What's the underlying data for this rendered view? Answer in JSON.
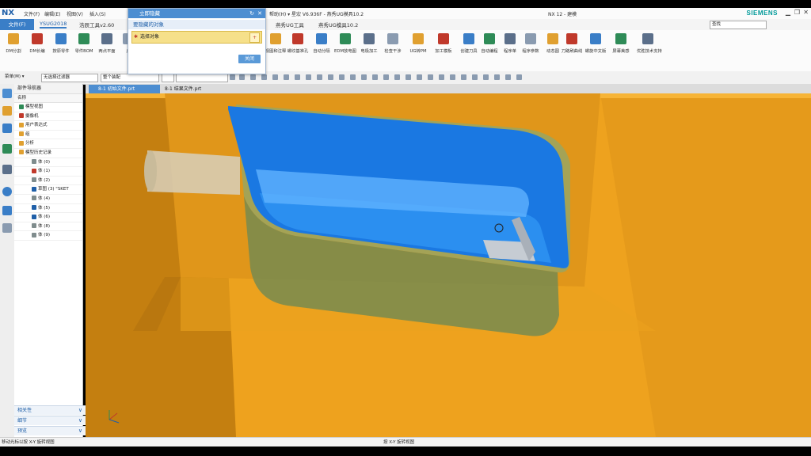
{
  "app": {
    "logo": "NX",
    "title": "NX 12 - 建模",
    "brand": "SIEMENS",
    "accent": "#3a7ec7",
    "menu": [
      "文件(F)",
      "编辑(E)",
      "视图(V)",
      "插入(S)"
    ],
    "secondary_window": "帮助(H) ▾ 星宏 V6.936F - 燕秀UG模具10.2"
  },
  "popup": {
    "title": "立即隐藏",
    "section": "要隐藏的对象",
    "row_label": "选择对象",
    "ok_label": "关闭"
  },
  "ribbon_tabs": {
    "file": "文件(F)",
    "tabs": [
      "YSUG2018",
      "浩辰工具v2.60",
      "燕秀UG工具",
      "燕秀UG模具10.2"
    ],
    "search_placeholder": "查找"
  },
  "ribbon_buttons": [
    "DM分割",
    "DM长编",
    "按原零件",
    "零件BOM",
    "两点平面",
    "虚",
    "视图和注释",
    "螺纹基准孔",
    "自动分隔",
    "EDM放电图",
    "电极加工",
    "检查干涉",
    "UG转PM",
    "加工模板",
    "创建刀具",
    "自动编程",
    "程序单",
    "程序参数",
    "动态圆",
    "刀路刷曲线",
    "螺旋中文版",
    "屏幕美感",
    "优胜技术支持"
  ],
  "toolbar2": {
    "menu_label": "菜单(M) ▾",
    "filter_label": "无选择过滤器",
    "assembly_label": "整个装配"
  },
  "navigator": {
    "title": "部件导航器",
    "column": "名称",
    "items": [
      {
        "label": "模型视图",
        "color": "#2e8b57"
      },
      {
        "label": "摄像机",
        "color": "#c0392b"
      },
      {
        "label": "用户表达式",
        "color": "#e0a030"
      },
      {
        "label": "组",
        "color": "#e0a030"
      },
      {
        "label": "分析",
        "color": "#e0a030"
      },
      {
        "label": "模型历史记录",
        "color": "#e0a030"
      },
      {
        "label": "体 (0)",
        "color": "#7f8c8d"
      },
      {
        "label": "体 (1)",
        "color": "#c0392b"
      },
      {
        "label": "体 (2)",
        "color": "#7f8c8d"
      },
      {
        "label": "草图 (3) \"SKET",
        "color": "#1f5fa8"
      },
      {
        "label": "体 (4)",
        "color": "#7f8c8d"
      },
      {
        "label": "体 (5)",
        "color": "#1f5fa8"
      },
      {
        "label": "体 (6)",
        "color": "#1f5fa8"
      },
      {
        "label": "体 (8)",
        "color": "#7f8c8d"
      },
      {
        "label": "体 (9)",
        "color": "#7f8c8d"
      }
    ],
    "panels": [
      "相关性",
      "细节",
      "预览"
    ]
  },
  "doc_tabs": [
    "8-1 初始文件.prt",
    "8-1 结果文件.prt"
  ],
  "status": {
    "left": "移动光标以按 X-Y 旋转视图",
    "center": "按 X-Y 旋转视图"
  },
  "viewport_colors": {
    "mold": "#f0a020",
    "mold_dark": "#c47f10",
    "cavity": "#1877e0",
    "glass": "#8aa870"
  }
}
